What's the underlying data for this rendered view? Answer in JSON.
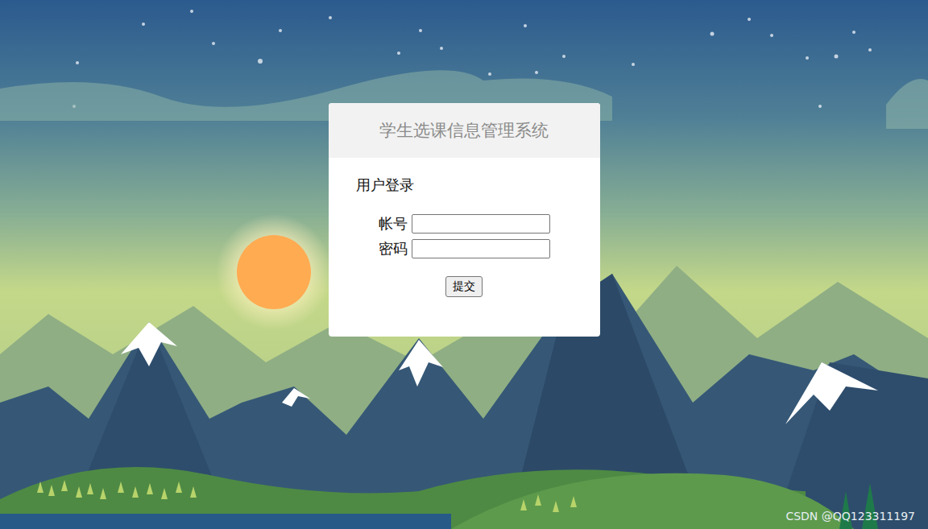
{
  "window": {
    "title": "学生选课信息管理系统"
  },
  "login": {
    "heading": "用户登录",
    "fields": [
      {
        "label": "帐号",
        "kind": "text",
        "value": ""
      },
      {
        "label": "密码",
        "kind": "password",
        "value": ""
      }
    ],
    "submit": "提交"
  },
  "watermark": "CSDN @QQ123311197"
}
